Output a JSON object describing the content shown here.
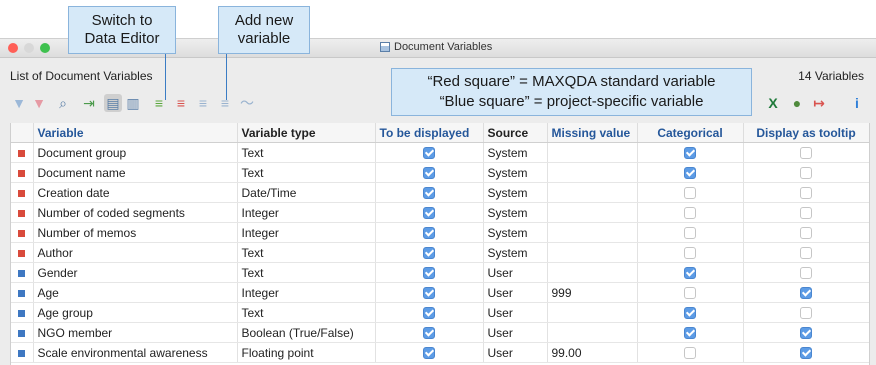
{
  "callouts": {
    "switch_editor": "Switch to\nData Editor",
    "add_variable": "Add new\nvariable",
    "legend_red": "“Red square” = MAXQDA standard variable",
    "legend_blue": "“Blue square” = project-specific variable"
  },
  "window": {
    "title": "Document Variables"
  },
  "header": {
    "list_label": "List of Document Variables",
    "count_label": "14 Variables"
  },
  "toolbar": {
    "left": [
      {
        "name": "filter-icon",
        "glyph": "▼",
        "color": "#9cb8d8"
      },
      {
        "name": "filter-clear-icon",
        "glyph": "▼",
        "color": "#e69aa4"
      },
      {
        "name": "search-icon",
        "glyph": "⌕",
        "color": "#5b7fa8"
      },
      {
        "name": "import-icon",
        "glyph": "⇥",
        "color": "#4b9a4b"
      },
      {
        "name": "data-editor-icon",
        "glyph": "▤",
        "color": "#5b7fa8"
      },
      {
        "name": "variable-list-icon",
        "glyph": "▥",
        "color": "#5b7fa8"
      },
      {
        "name": "add-variable-icon",
        "glyph": "≡",
        "color": "#5ca83e"
      },
      {
        "name": "delete-variable-icon",
        "glyph": "≡",
        "color": "#d9534f"
      },
      {
        "name": "numeric-variable-icon",
        "glyph": "≡",
        "color": "#9ab3cf"
      },
      {
        "name": "text-variable-icon",
        "glyph": "≡",
        "color": "#9ab3cf"
      },
      {
        "name": "chart-icon",
        "glyph": "〜",
        "color": "#9ab3cf"
      }
    ],
    "right": [
      {
        "name": "excel-icon",
        "glyph": "X",
        "color": "#1f7a3a"
      },
      {
        "name": "web-export-icon",
        "glyph": "●",
        "color": "#4f8a3c"
      },
      {
        "name": "export-icon",
        "glyph": "↦",
        "color": "#d9534f"
      },
      {
        "name": "info-icon",
        "glyph": "i",
        "color": "#2f7fd8"
      }
    ]
  },
  "colors": {
    "standard": "#d94a3c",
    "project": "#3e78c2"
  },
  "table": {
    "headers": [
      "Variable",
      "Variable type",
      "To be displayed",
      "Source",
      "Missing value",
      "Categorical",
      "Display as tooltip"
    ],
    "rows": [
      {
        "marker": "standard",
        "variable": "Document group",
        "type": "Text",
        "displayed": true,
        "source": "System",
        "missing": "",
        "categorical": true,
        "tooltip": false
      },
      {
        "marker": "standard",
        "variable": "Document name",
        "type": "Text",
        "displayed": true,
        "source": "System",
        "missing": "",
        "categorical": true,
        "tooltip": false
      },
      {
        "marker": "standard",
        "variable": "Creation date",
        "type": "Date/Time",
        "displayed": true,
        "source": "System",
        "missing": "",
        "categorical": false,
        "tooltip": false
      },
      {
        "marker": "standard",
        "variable": "Number of coded segments",
        "type": "Integer",
        "displayed": true,
        "source": "System",
        "missing": "",
        "categorical": false,
        "tooltip": false
      },
      {
        "marker": "standard",
        "variable": "Number of memos",
        "type": "Integer",
        "displayed": true,
        "source": "System",
        "missing": "",
        "categorical": false,
        "tooltip": false
      },
      {
        "marker": "standard",
        "variable": "Author",
        "type": "Text",
        "displayed": true,
        "source": "System",
        "missing": "",
        "categorical": false,
        "tooltip": false
      },
      {
        "marker": "project",
        "variable": "Gender",
        "type": "Text",
        "displayed": true,
        "source": "User",
        "missing": "",
        "categorical": true,
        "tooltip": false
      },
      {
        "marker": "project",
        "variable": "Age",
        "type": "Integer",
        "displayed": true,
        "source": "User",
        "missing": "999",
        "categorical": false,
        "tooltip": true
      },
      {
        "marker": "project",
        "variable": "Age group",
        "type": "Text",
        "displayed": true,
        "source": "User",
        "missing": "",
        "categorical": true,
        "tooltip": false
      },
      {
        "marker": "project",
        "variable": "NGO member",
        "type": "Boolean (True/False)",
        "displayed": true,
        "source": "User",
        "missing": "",
        "categorical": true,
        "tooltip": true
      },
      {
        "marker": "project",
        "variable": "Scale environmental awareness",
        "type": "Floating point",
        "displayed": true,
        "source": "User",
        "missing": "99.00",
        "categorical": false,
        "tooltip": true
      }
    ]
  }
}
